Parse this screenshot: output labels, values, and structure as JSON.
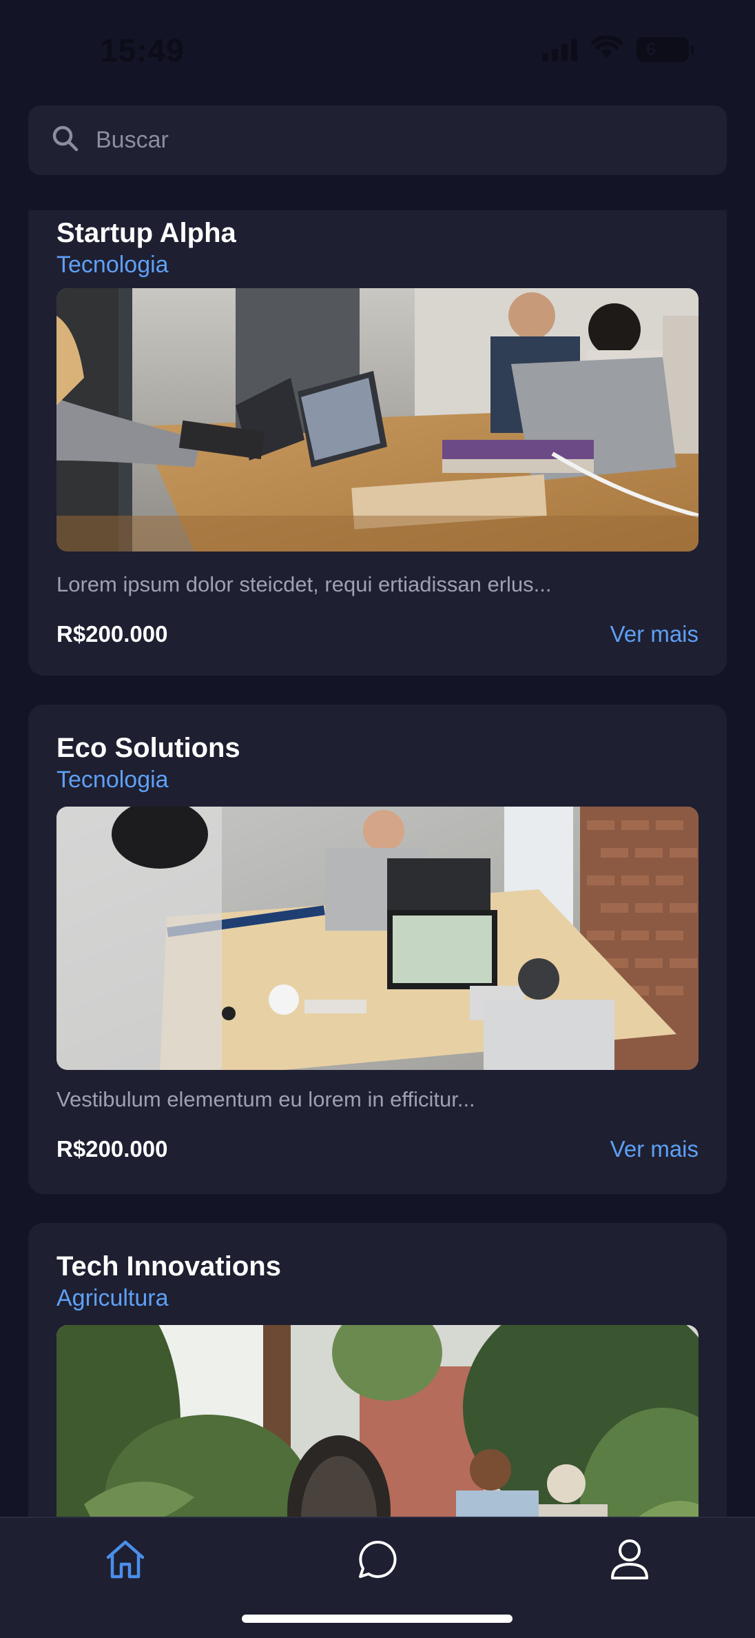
{
  "status_bar": {
    "time": "15:49",
    "battery": "6"
  },
  "search": {
    "placeholder": "Buscar"
  },
  "cards": [
    {
      "title": "Startup Alpha",
      "category": "Tecnologia",
      "description": "Lorem ipsum dolor steicdet, requi ertiadissan erlus...",
      "price": "R$200.000",
      "link": "Ver mais"
    },
    {
      "title": "Eco Solutions",
      "category": "Tecnologia",
      "description": "Vestibulum elementum eu lorem in efficitur...",
      "price": "R$200.000",
      "link": "Ver mais"
    },
    {
      "title": "Tech Innovations",
      "category": "Agricultura",
      "description": "",
      "price": "",
      "link": ""
    }
  ],
  "tab_bar": {
    "items": [
      {
        "icon": "home-icon",
        "active": true
      },
      {
        "icon": "chat-icon",
        "active": false
      },
      {
        "icon": "user-icon",
        "active": false
      }
    ]
  },
  "colors": {
    "background": "#131425",
    "card": "#1e1f31",
    "accent": "#5ea0f5",
    "muted_text": "#9fa1b0"
  }
}
